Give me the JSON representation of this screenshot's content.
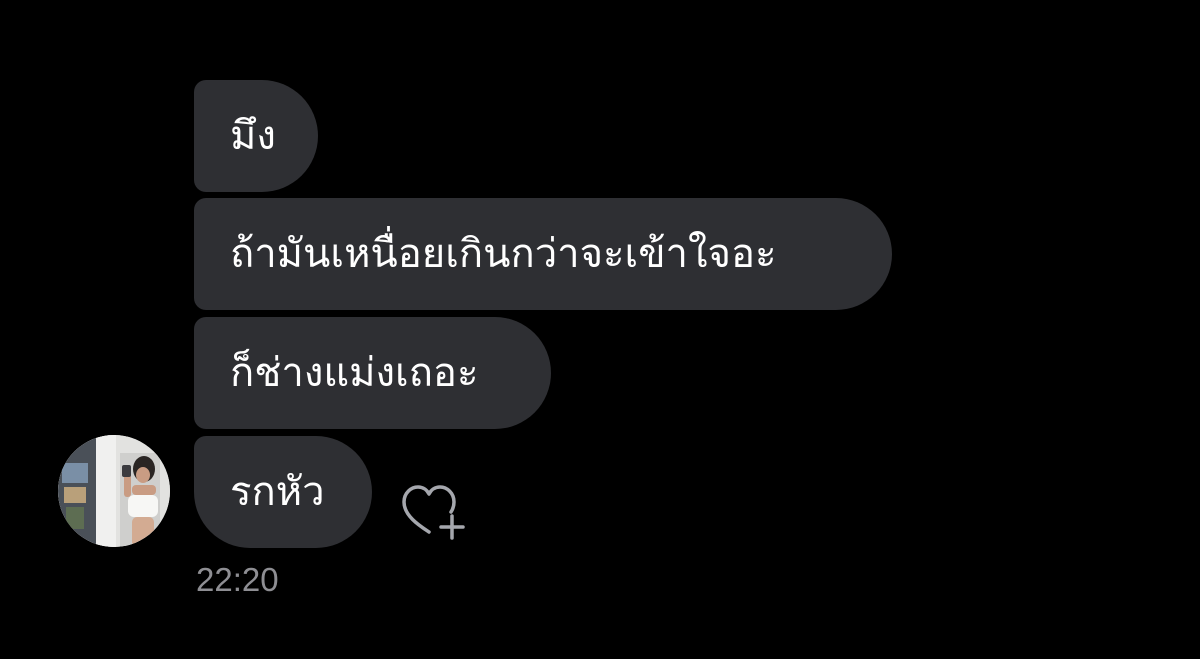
{
  "conversation": {
    "messages": [
      {
        "text": "มึง"
      },
      {
        "text": "ถ้ามันเหนื่อยเกินกว่าจะเข้าใจอะ"
      },
      {
        "text": "ก็ช่างแม่งเถอะ"
      },
      {
        "text": "รกหัว"
      }
    ],
    "timestamp": "22:20"
  },
  "icons": {
    "avatar": "contact-avatar",
    "reaction": "heart-plus-icon"
  },
  "colors": {
    "background": "#000000",
    "bubble": "#2e2f33",
    "message_text": "#ffffff",
    "timestamp": "#8e8e93",
    "reaction_icon": "#a5a7ad"
  }
}
